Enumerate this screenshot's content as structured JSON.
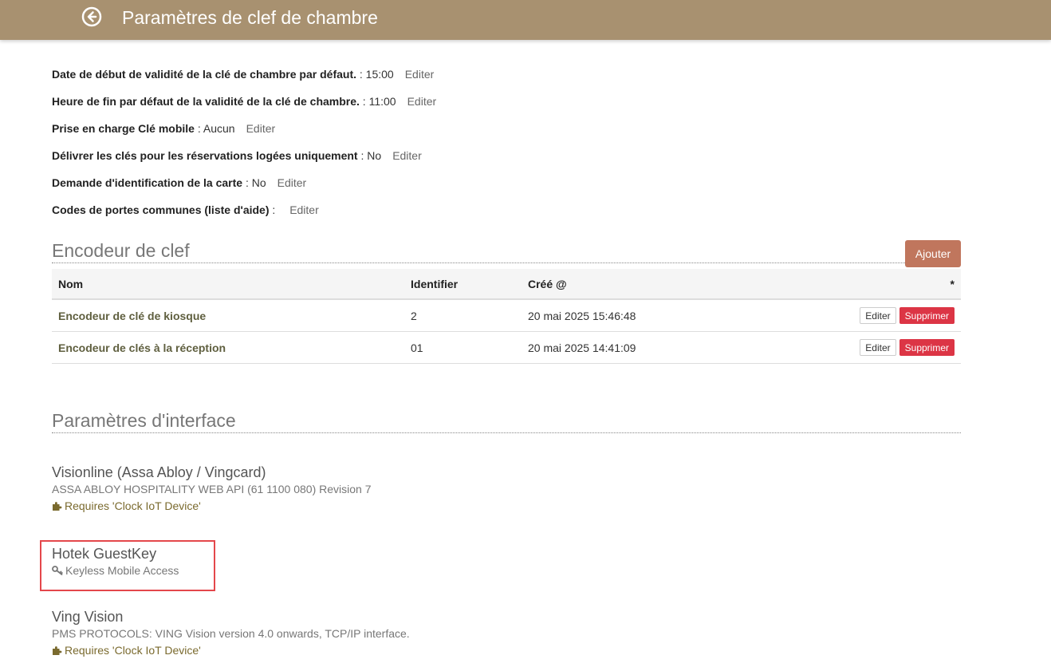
{
  "header": {
    "title": "Paramètres de clef de chambre"
  },
  "settings": [
    {
      "label": "Date de début de validité de la clé de chambre par défaut.",
      "sep": " : ",
      "value": "15:00",
      "edit": "Editer"
    },
    {
      "label": "Heure de fin par défaut de la validité de la clé de chambre.",
      "sep": " : ",
      "value": "11:00",
      "edit": "Editer"
    },
    {
      "label": "Prise en charge Clé mobile",
      "sep": " : ",
      "value": "Aucun",
      "edit": "Editer"
    },
    {
      "label": "Délivrer les clés pour les réservations logées uniquement",
      "sep": " : ",
      "value": "No",
      "edit": "Editer"
    },
    {
      "label": "Demande d'identification de la carte",
      "sep": " : ",
      "value": "No",
      "edit": "Editer"
    },
    {
      "label": "Codes de portes communes (liste d'aide)",
      "sep": " : ",
      "value": "",
      "edit": "Editer"
    }
  ],
  "encoder": {
    "title": "Encodeur de clef",
    "add_label": "Ajouter",
    "columns": {
      "name": "Nom",
      "identifier": "Identifier",
      "created": "Créé @",
      "star": "*"
    },
    "rows": [
      {
        "name": "Encodeur de clé de kiosque",
        "identifier": "2",
        "created": "20 mai 2025 15:46:48",
        "edit": "Editer",
        "delete": "Supprimer"
      },
      {
        "name": "Encodeur de clés à la réception",
        "identifier": "01",
        "created": "20 mai 2025 14:41:09",
        "edit": "Editer",
        "delete": "Supprimer"
      }
    ]
  },
  "interfaces": {
    "title": "Paramètres d'interface",
    "items": [
      {
        "name": "Visionline (Assa Abloy / Vingcard)",
        "desc": "ASSA ABLOY HOSPITALITY WEB API (61 1100 080) Revision 7",
        "requires": "Requires 'Clock IoT Device'",
        "icon": "puzzle-icon"
      },
      {
        "name": "Hotek GuestKey",
        "feature": "Keyless Mobile Access",
        "icon": "key-icon"
      },
      {
        "name": "Ving Vision",
        "desc": "PMS PROTOCOLS: VING Vision version 4.0 onwards, TCP/IP interface.",
        "requires": "Requires 'Clock IoT Device'",
        "icon": "puzzle-icon"
      }
    ]
  },
  "colors": {
    "header_bg": "#a89170",
    "add_button": "#c0765d",
    "delete_button": "#dc3545",
    "highlight_border": "#e4474b"
  }
}
